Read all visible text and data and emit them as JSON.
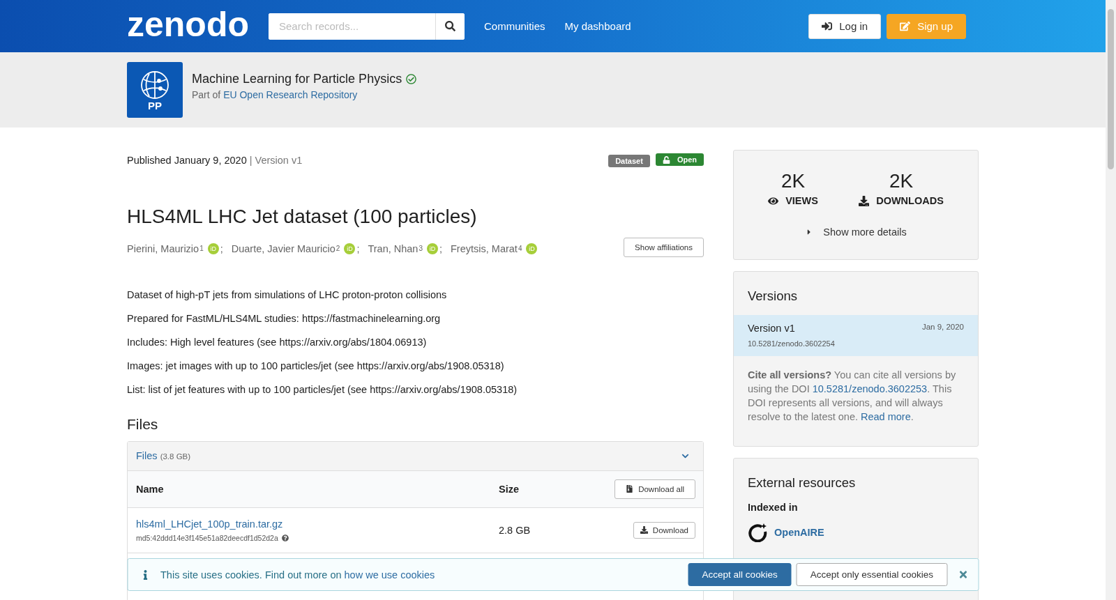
{
  "header": {
    "logo": "zenodo",
    "search": {
      "placeholder": "Search records..."
    },
    "nav": [
      "Communities",
      "My dashboard"
    ],
    "buttons": [
      {
        "kind": "login",
        "label": "Log in"
      },
      {
        "kind": "signup",
        "label": "Sign up"
      }
    ]
  },
  "community": {
    "logo_text": "PP",
    "title": "Machine Learning for Particle Physics",
    "verified": true,
    "part_of": "Part of ",
    "parent": "EU Open Research Repository"
  },
  "record": {
    "published": "Published January 9, 2020",
    "separator": "|",
    "version": "Version v1",
    "badges": [
      {
        "kind": "type",
        "label": "Dataset"
      },
      {
        "kind": "access",
        "label": "Open"
      }
    ],
    "title": "HLS4ML LHC Jet dataset (100 particles)",
    "authors": [
      {
        "name": "Pierini, Maurizio",
        "affiliation": "1",
        "orcid": "iD",
        "sep": ";"
      },
      {
        "name": "Duarte, Javier Mauricio",
        "affiliation": "2",
        "orcid": "iD",
        "sep": ";"
      },
      {
        "name": "Tran, Nhan",
        "affiliation": "3",
        "orcid": "iD",
        "sep": ";"
      },
      {
        "name": "Freytsis, Marat",
        "affiliation": "4",
        "orcid": "iD"
      }
    ],
    "show_affiliations": "Show affiliations",
    "description": [
      "Dataset of high-pT jets from simulations of LHC proton-proton collisions",
      "Prepared for FastML/HLS4ML studies: https://fastmachinelearning.org",
      "Includes: High level features (see https://arxiv.org/abs/1804.06913)",
      "Images: jet images with up to 100 particles/jet (see https://arxiv.org/abs/1908.05318)",
      "List: list of jet features with up to 100 particles/jet (see https://arxiv.org/abs/1908.05318)"
    ]
  },
  "files": {
    "heading": "Files",
    "panel_title": "Files",
    "total": "(3.8 GB)",
    "expanded": true,
    "columns": [
      "Name",
      "Size"
    ],
    "download_all": "Download all",
    "rows": [
      {
        "name": "hls4ml_LHCjet_100p_train.tar.gz",
        "checksum": "md5:42ddd14e3f145e51a82deecdf1d52d2a",
        "size": "2.8 GB",
        "action": "Download"
      }
    ]
  },
  "sidebar": {
    "stats": [
      {
        "kind": "views",
        "value": "2K",
        "label": "VIEWS"
      },
      {
        "kind": "downloads",
        "value": "2K",
        "label": "DOWNLOADS"
      }
    ],
    "more_details": "Show more details",
    "versions": {
      "heading": "Versions",
      "items": [
        {
          "label": "Version v1",
          "date": "Jan 9, 2020",
          "doi": "10.5281/zenodo.3602254",
          "selected": true
        }
      ],
      "cite": {
        "text": "**Cite all versions?** You can cite all versions by using the DOI ",
        "doi": "10.5281/zenodo.3602253",
        "middle": ". This DOI represents all versions, and will always resolve to the latest one. ",
        "link": "Read more",
        "end": "."
      }
    },
    "external": {
      "heading": "External resources",
      "subheading": "Indexed in",
      "items": [
        "OpenAIRE"
      ]
    }
  },
  "cookie_banner": {
    "text": "This site uses cookies. Find out more on ",
    "link": "how we use cookies",
    "accept_all": "Accept all cookies",
    "accept_essential": "Accept only essential cookies"
  }
}
